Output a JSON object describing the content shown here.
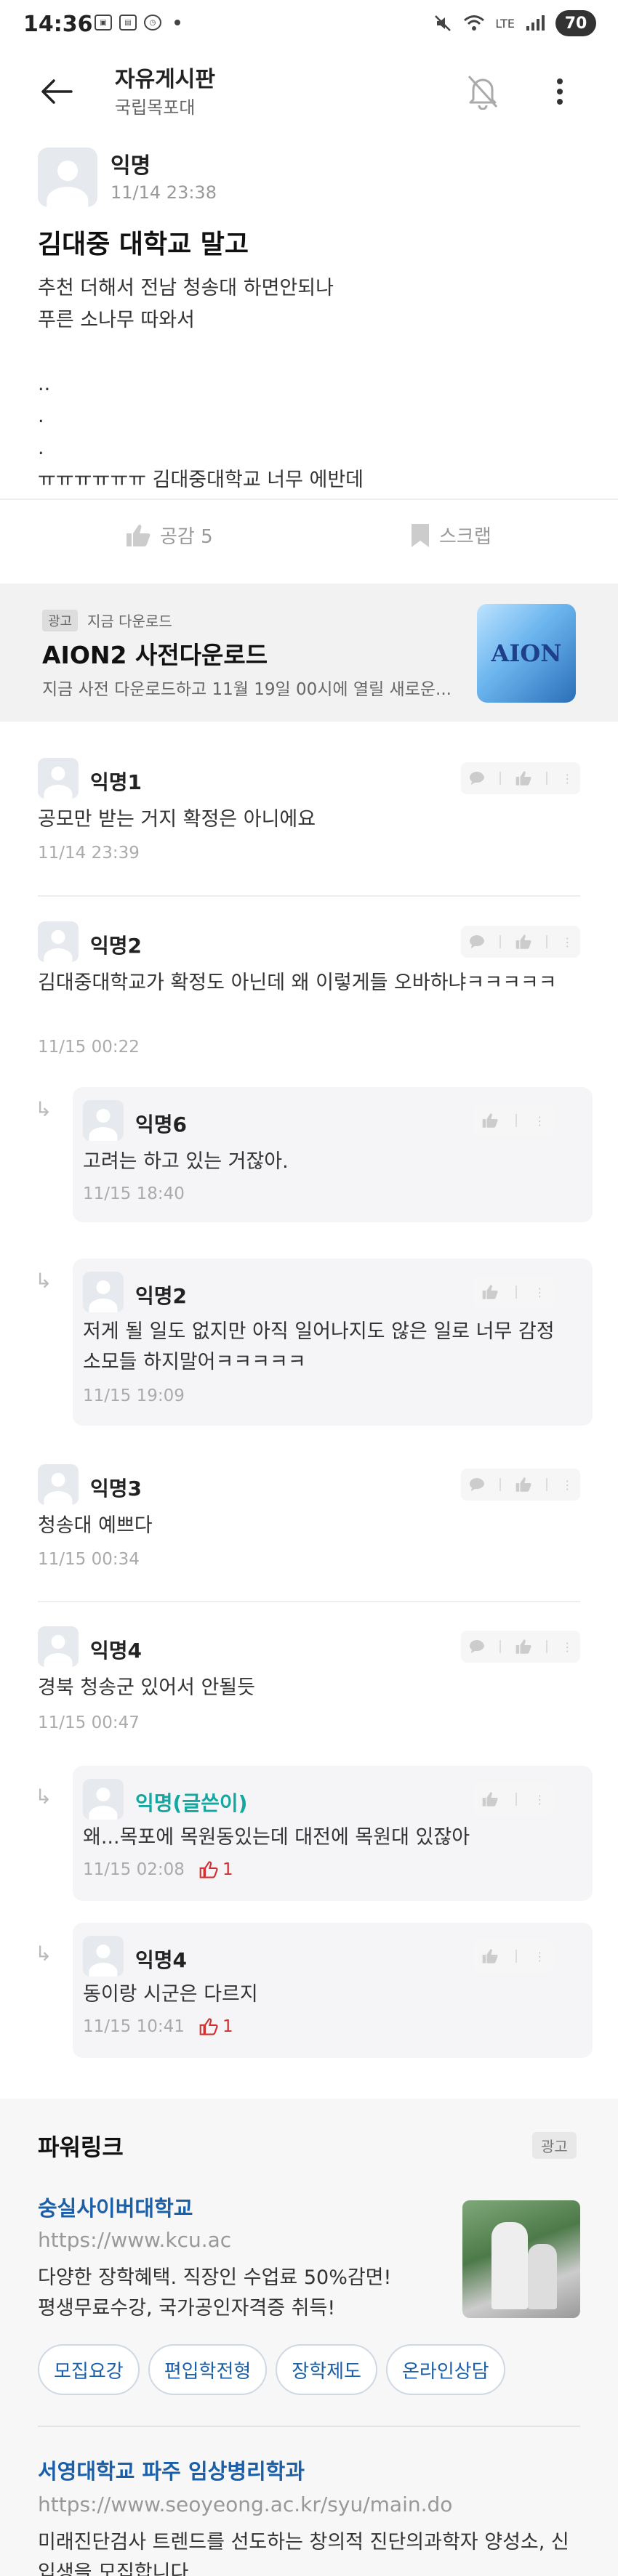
{
  "status_bar": {
    "time": "14:36",
    "battery": "70",
    "net": "LTE"
  },
  "appbar": {
    "title": "자유게시판",
    "subtitle": "국립목포대"
  },
  "post": {
    "author": "익명",
    "time": "11/14 23:38",
    "title": "김대중 대학교 말고",
    "body": "추천 더해서 전남 청송대 하면안되나\n푸른 소나무 따와서\n\n..\n.\n.\nㅠㅠㅠㅠㅠㅠ 김대중대학교 너무 에반데",
    "like_label": "공감 5",
    "scrap_label": "스크랩"
  },
  "ad": {
    "badge": "광고",
    "sub": "지금 다운로드",
    "title": "AION2 사전다운로드",
    "desc": "지금 사전 다운로드하고 11월 19일 00시에 열릴 새로운...",
    "logo_text": "AION"
  },
  "comments": [
    {
      "name": "익명1",
      "text": "공모만 받는 거지 확정은 아니에요",
      "time": "11/14 23:39"
    },
    {
      "name": "익명2",
      "text": "김대중대학교가 확정도 아닌데 왜 이렇게들 오바하냐ㅋㅋㅋㅋㅋ",
      "time": "11/15 00:22"
    },
    {
      "name": "익명6",
      "text": "고려는 하고 있는 거잖아.",
      "time": "11/15 18:40"
    },
    {
      "name": "익명2",
      "text": "저게 될 일도 없지만 아직 일어나지도 않은 일로 너무 감정소모들 하지말어ㅋㅋㅋㅋㅋ",
      "time": "11/15 19:09"
    },
    {
      "name": "익명3",
      "text": "청송대 예쁘다",
      "time": "11/15 00:34"
    },
    {
      "name": "익명4",
      "text": "경북 청송군 있어서 안될듯",
      "time": "11/15 00:47"
    },
    {
      "name": "익명(글쓴이)",
      "text": "왜...목포에 목원동있는데 대전에 목원대 있잖아",
      "time": "11/15 02:08",
      "likes": "1"
    },
    {
      "name": "익명4",
      "text": "동이랑 시군은 다르지",
      "time": "11/15 10:41",
      "likes": "1"
    }
  ],
  "powerlink": {
    "title": "파워링크",
    "badge": "광고",
    "ads": [
      {
        "name": "숭실사이버대학교",
        "url": "https://www.kcu.ac",
        "desc": "다양한 장학혜택. 직장인 수업료 50%감면!\n평생무료수강, 국가공인자격증 취득!",
        "chips": [
          "모집요강",
          "편입학전형",
          "장학제도",
          "온라인상담"
        ]
      },
      {
        "name": "서영대학교 파주 임상병리학과",
        "url": "https://www.seoyeong.ac.kr/syu/main.do",
        "desc": "미래진단검사 트렌드를 선도하는 창의적 진단의과학자 양성소, 신입생을 모집합니다"
      }
    ]
  },
  "colors": {
    "accent_teal": "#14a6a0",
    "like_red": "#d32f2f",
    "link_blue": "#1a5fa8"
  }
}
